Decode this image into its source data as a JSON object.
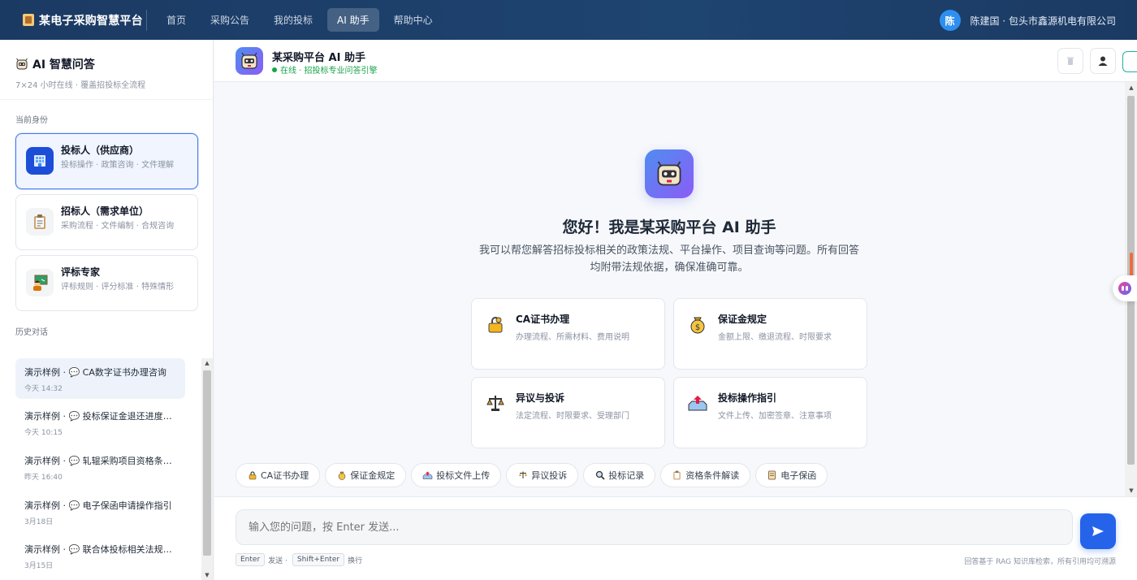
{
  "topbar": {
    "brand": "某电子采购智慧平台",
    "nav": [
      "首页",
      "采购公告",
      "我的投标",
      "AI 助手",
      "帮助中心"
    ],
    "active_nav": "AI 助手",
    "user_avatar": "陈",
    "user_info": "陈建国 · 包头市鑫源机电有限公司"
  },
  "sidebar": {
    "title": "AI 智慧问答",
    "subtitle": "7×24 小时在线 · 覆盖招投标全流程",
    "role_label": "当前身份",
    "roles": [
      {
        "title": "投标人（供应商）",
        "desc": "投标操作 · 政策咨询 · 文件理解",
        "icon": "building-icon",
        "active": true
      },
      {
        "title": "招标人（需求单位）",
        "desc": "采购流程 · 文件编制 · 合规咨询",
        "icon": "clipboard-icon",
        "active": false
      },
      {
        "title": "评标专家",
        "desc": "评标规则 · 评分标准 · 特殊情形",
        "icon": "teacher-icon",
        "active": false
      }
    ],
    "history_label": "历史对话",
    "history": [
      {
        "title": "演示样例 · 💬 CA数字证书办理咨询",
        "time": "今天 14:32"
      },
      {
        "title": "演示样例 · 💬 投标保证金退还进度查询",
        "time": "今天 10:15"
      },
      {
        "title": "演示样例 · 💬 轧辊采购项目资格条件解读",
        "time": "昨天 16:40"
      },
      {
        "title": "演示样例 · 💬 电子保函申请操作指引",
        "time": "3月18日"
      },
      {
        "title": "演示样例 · 💬 联合体投标相关法规咨询",
        "time": "3月15日"
      }
    ]
  },
  "chat": {
    "title": "某采购平台 AI 助手",
    "status": "在线 · 招投标专业问答引擎",
    "welcome_title": "您好！我是某采购平台 AI 助手",
    "welcome_desc": "我可以帮您解答招标投标相关的政策法规、平台操作、项目查询等问题。所有回答均附带法规依据，确保准确可靠。",
    "cards": [
      {
        "title": "CA证书办理",
        "desc": "办理流程、所需材料、费用说明",
        "icon": "lock-key-icon"
      },
      {
        "title": "保证金规定",
        "desc": "金额上限、缴退流程、时限要求",
        "icon": "money-bag-icon"
      },
      {
        "title": "异议与投诉",
        "desc": "法定流程、时限要求、受理部门",
        "icon": "scales-icon"
      },
      {
        "title": "投标操作指引",
        "desc": "文件上传、加密签章、注意事项",
        "icon": "inbox-upload-icon"
      }
    ],
    "chips": [
      {
        "label": "CA证书办理",
        "icon": "lock-key-icon"
      },
      {
        "label": "保证金规定",
        "icon": "money-bag-icon"
      },
      {
        "label": "投标文件上传",
        "icon": "inbox-upload-icon"
      },
      {
        "label": "异议投诉",
        "icon": "scales-icon"
      },
      {
        "label": "投标记录",
        "icon": "search-icon"
      },
      {
        "label": "资格条件解读",
        "icon": "clipboard-icon"
      },
      {
        "label": "电子保函",
        "icon": "scroll-icon"
      }
    ],
    "input_placeholder": "输入您的问题，按 Enter 发送...",
    "hint_enter": "Enter",
    "hint_send": "发送 ·",
    "hint_shift": "Shift+Enter",
    "hint_newline": "换行",
    "rag_note": "回答基于 RAG 知识库检索，所有引用均可溯源"
  },
  "colors": {
    "topbar": "#1b3a63",
    "accent": "#2563eb",
    "online": "#16a34a"
  }
}
